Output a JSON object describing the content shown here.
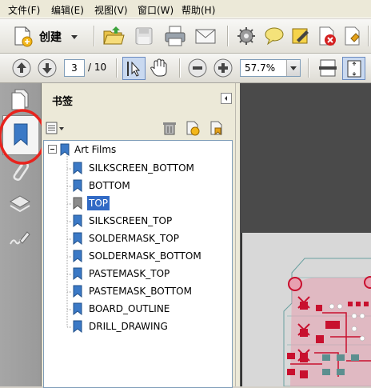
{
  "menu": {
    "file": "文件(F)",
    "edit": "编辑(E)",
    "view": "视图(V)",
    "window": "窗口(W)",
    "help": "帮助(H)"
  },
  "toolbar": {
    "create_label": "创建"
  },
  "nav": {
    "page_current": "3",
    "page_total": "/ 10",
    "zoom": "57.7%"
  },
  "bookmarks_panel": {
    "title": "书签",
    "root": "Art Films",
    "items": [
      {
        "label": "SILKSCREEN_BOTTOM",
        "selected": false
      },
      {
        "label": "BOTTOM",
        "selected": false
      },
      {
        "label": "TOP",
        "selected": true
      },
      {
        "label": "SILKSCREEN_TOP",
        "selected": false
      },
      {
        "label": "SOLDERMASK_TOP",
        "selected": false
      },
      {
        "label": "SOLDERMASK_BOTTOM",
        "selected": false
      },
      {
        "label": "PASTEMASK_TOP",
        "selected": false
      },
      {
        "label": "PASTEMASK_BOTTOM",
        "selected": false
      },
      {
        "label": "BOARD_OUTLINE",
        "selected": false
      },
      {
        "label": "DRILL_DRAWING",
        "selected": false
      }
    ]
  },
  "colors": {
    "selection": "#316ac5",
    "annotation_circle": "#e8231d",
    "pcb_board": "#d8d8d8",
    "pcb_copper": "#c8102e"
  }
}
